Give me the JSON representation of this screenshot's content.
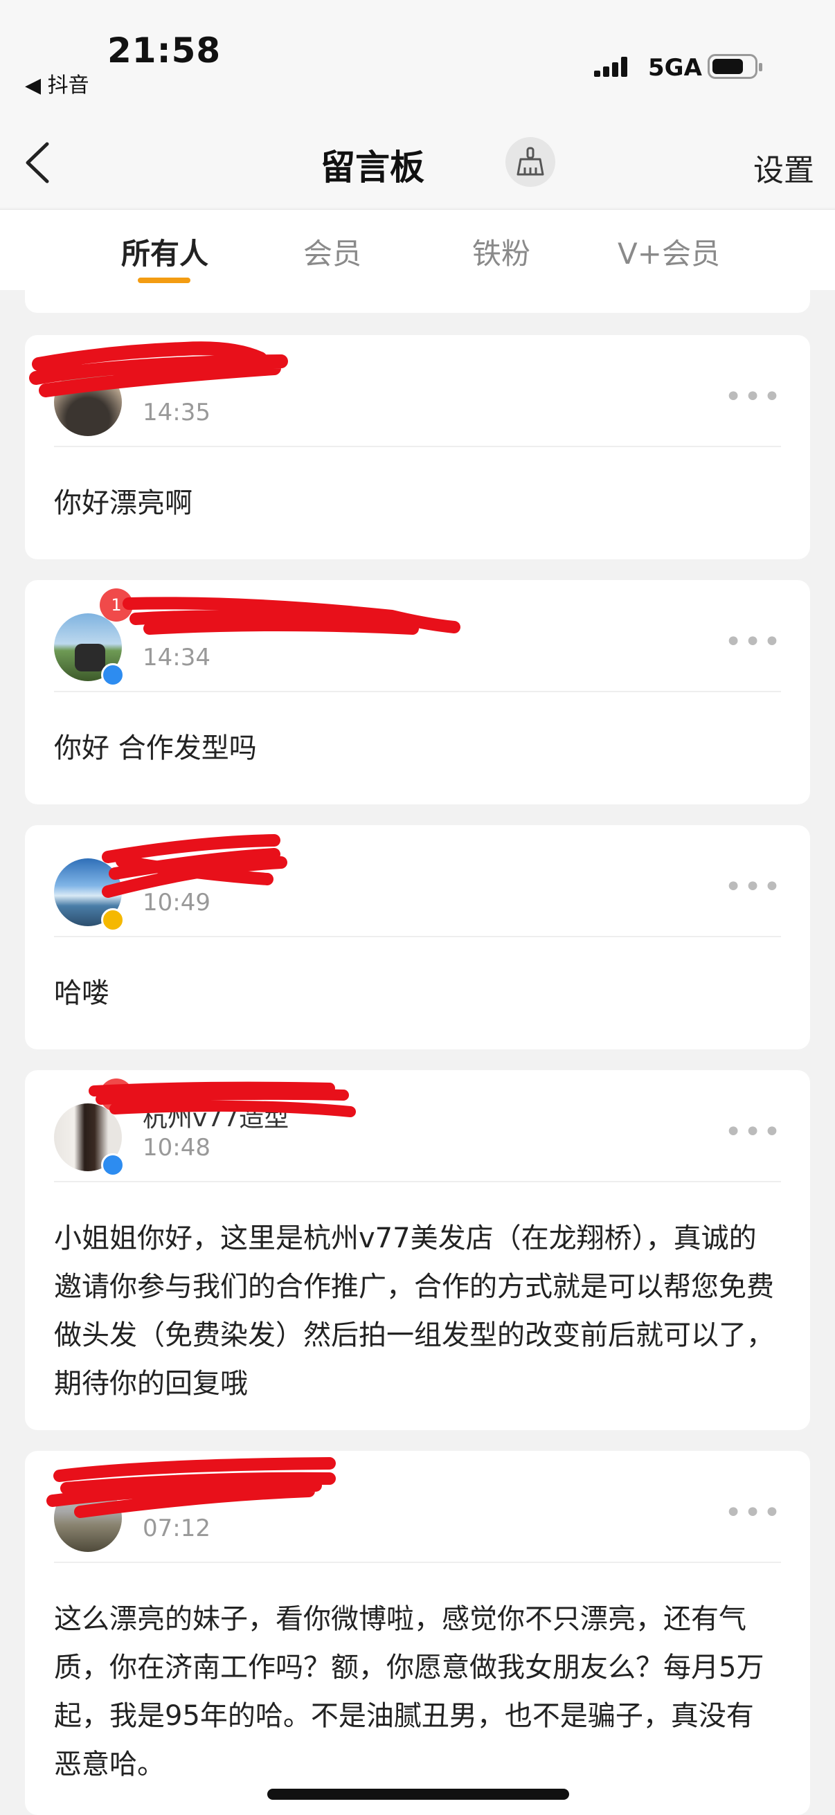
{
  "status_bar": {
    "time": "21:58",
    "back_app": "◀ 抖音",
    "network": "5GA"
  },
  "nav": {
    "title": "留言板",
    "settings": "设置"
  },
  "tabs": [
    "所有人",
    "会员",
    "铁粉",
    "V+会员"
  ],
  "messages": [
    {
      "username": "",
      "time": "14:35",
      "text": "你好漂亮啊",
      "badge": ""
    },
    {
      "username": "",
      "time": "14:34",
      "text": "你好  合作发型吗",
      "badge": "1"
    },
    {
      "username": "",
      "time": "10:49",
      "text": "哈喽",
      "badge": ""
    },
    {
      "username": "杭州v77造型",
      "time": "10:48",
      "text": "小姐姐你好，这里是杭州v77美发店（在龙翔桥），真诚的邀请你参与我们的合作推广，合作的方式就是可以帮您免费做头发（免费染发）然后拍一组发型的改变前后就可以了，期待你的回复哦",
      "badge": "1"
    },
    {
      "username": "",
      "time": "07:12",
      "text": "这么漂亮的妹子，看你微博啦，感觉你不只漂亮，还有气质，你在济南工作吗？额，你愿意做我女朋友么？每月5万起，我是95年的哈。不是油腻丑男，也不是骗子，真没有恶意哈。",
      "badge": ""
    }
  ],
  "colors": {
    "accent": "#f39c12",
    "badge": "#f04a4a",
    "verify_blue": "#2d8cf0",
    "verify_gold": "#f5b800",
    "redaction": "#e8101a"
  }
}
